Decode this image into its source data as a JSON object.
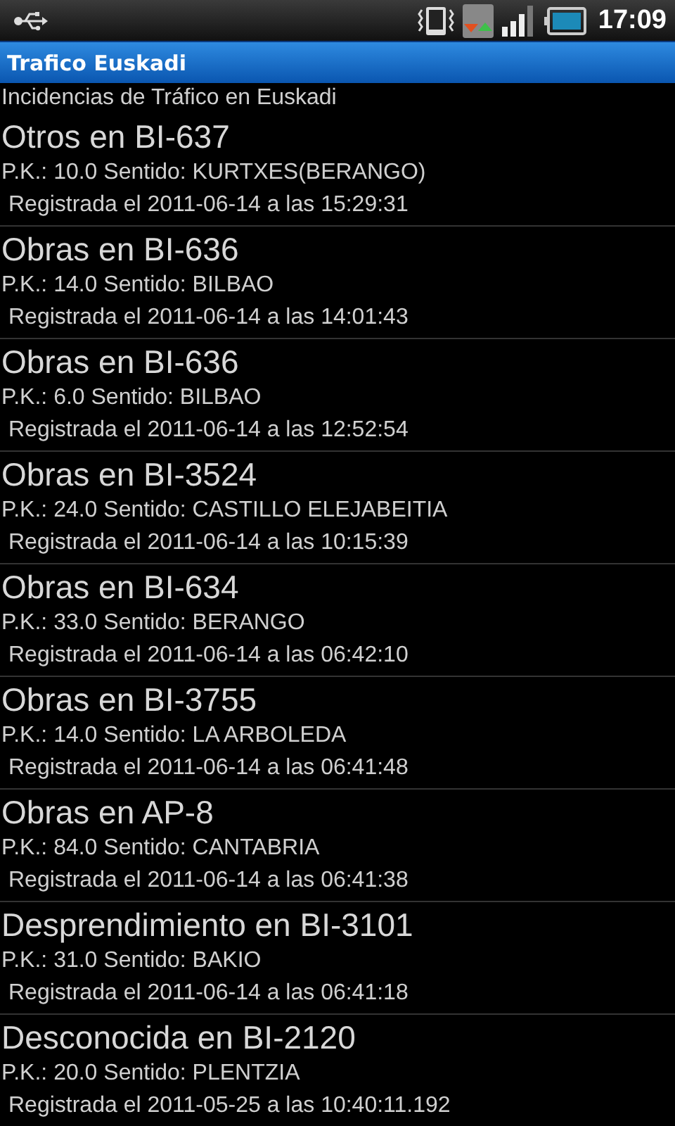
{
  "status_bar": {
    "time": "17:09"
  },
  "title_bar": {
    "title": "Trafico Euskadi"
  },
  "subtitle": "Incidencias de Tráfico en Euskadi",
  "incidents": [
    {
      "title": "Otros en BI-637",
      "location": "P.K.: 10.0 Sentido: KURTXES(BERANGO)",
      "registered": "Registrada el 2011-06-14 a las 15:29:31"
    },
    {
      "title": "Obras en BI-636",
      "location": "P.K.: 14.0 Sentido: BILBAO",
      "registered": "Registrada el 2011-06-14 a las 14:01:43"
    },
    {
      "title": "Obras en BI-636",
      "location": "P.K.: 6.0 Sentido: BILBAO",
      "registered": "Registrada el 2011-06-14 a las 12:52:54"
    },
    {
      "title": "Obras en BI-3524",
      "location": "P.K.: 24.0 Sentido: CASTILLO ELEJABEITIA",
      "registered": "Registrada el 2011-06-14 a las 10:15:39"
    },
    {
      "title": "Obras en BI-634",
      "location": "P.K.: 33.0 Sentido: BERANGO",
      "registered": "Registrada el 2011-06-14 a las 06:42:10"
    },
    {
      "title": "Obras en BI-3755",
      "location": "P.K.: 14.0 Sentido: LA ARBOLEDA",
      "registered": "Registrada el 2011-06-14 a las 06:41:48"
    },
    {
      "title": "Obras en AP-8",
      "location": "P.K.: 84.0 Sentido: CANTABRIA",
      "registered": "Registrada el 2011-06-14 a las 06:41:38"
    },
    {
      "title": "Desprendimiento en BI-3101",
      "location": "P.K.: 31.0 Sentido: BAKIO",
      "registered": "Registrada el 2011-06-14 a las 06:41:18"
    },
    {
      "title": "Desconocida en BI-2120",
      "location": "P.K.: 20.0 Sentido: PLENTZIA",
      "registered": "Registrada el 2011-05-25 a las 10:40:11.192"
    }
  ]
}
